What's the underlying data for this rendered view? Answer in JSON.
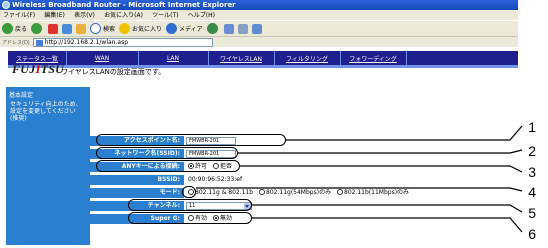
{
  "window": {
    "title": "Wireless Broadband Router - Microsoft Internet Explorer"
  },
  "menu": [
    "ファイル(F)",
    "編集(E)",
    "表示(V)",
    "お気に入り(A)",
    "ツール(T)",
    "ヘルプ(H)"
  ],
  "toolbar": {
    "back": "戻る",
    "search": "検索",
    "favorites": "お気に入り",
    "media": "メディア"
  },
  "address": {
    "label": "アドレス(D)",
    "url": "http://192.168.2.1/wlan.asp"
  },
  "nav": [
    "ステータス一覧",
    "WAN",
    "LAN",
    "ワイヤレスLAN",
    "フィルタリング",
    "フォワーディング"
  ],
  "brand": {
    "logo_a": "FUJ",
    "logo_i": "I",
    "logo_b": "TSU"
  },
  "page": {
    "title": "ワイヤレスLANの設定画面です。"
  },
  "section": {
    "title": "基本設定",
    "note": "セキュリティ向上のため、設定を変更してください(推奨)"
  },
  "rows": {
    "ap_name": {
      "label": "アクセスポイント名:",
      "value": "FMWBR-201"
    },
    "ssid": {
      "label": "ネットワーク名(SSID):",
      "value": "FMWBR-201"
    },
    "any": {
      "label": "ANYキーによる接続:",
      "opt_on": "許可",
      "opt_off": "拒否"
    },
    "bssid": {
      "label": "BSSID:",
      "value": "00:90:96:52:33:ef"
    },
    "mode": {
      "label": "モード:",
      "opt1": "802.11g & 802.11b",
      "opt2": "802.11g(54Mbps)のみ",
      "opt3": "802.11b(11Mbps)のみ"
    },
    "channel": {
      "label": "チャンネル:",
      "value": "11"
    },
    "superg": {
      "label": "Super G:",
      "opt_on": "有効",
      "opt_off": "無効"
    }
  },
  "callouts": [
    "1",
    "2",
    "3",
    "4",
    "5",
    "6"
  ]
}
